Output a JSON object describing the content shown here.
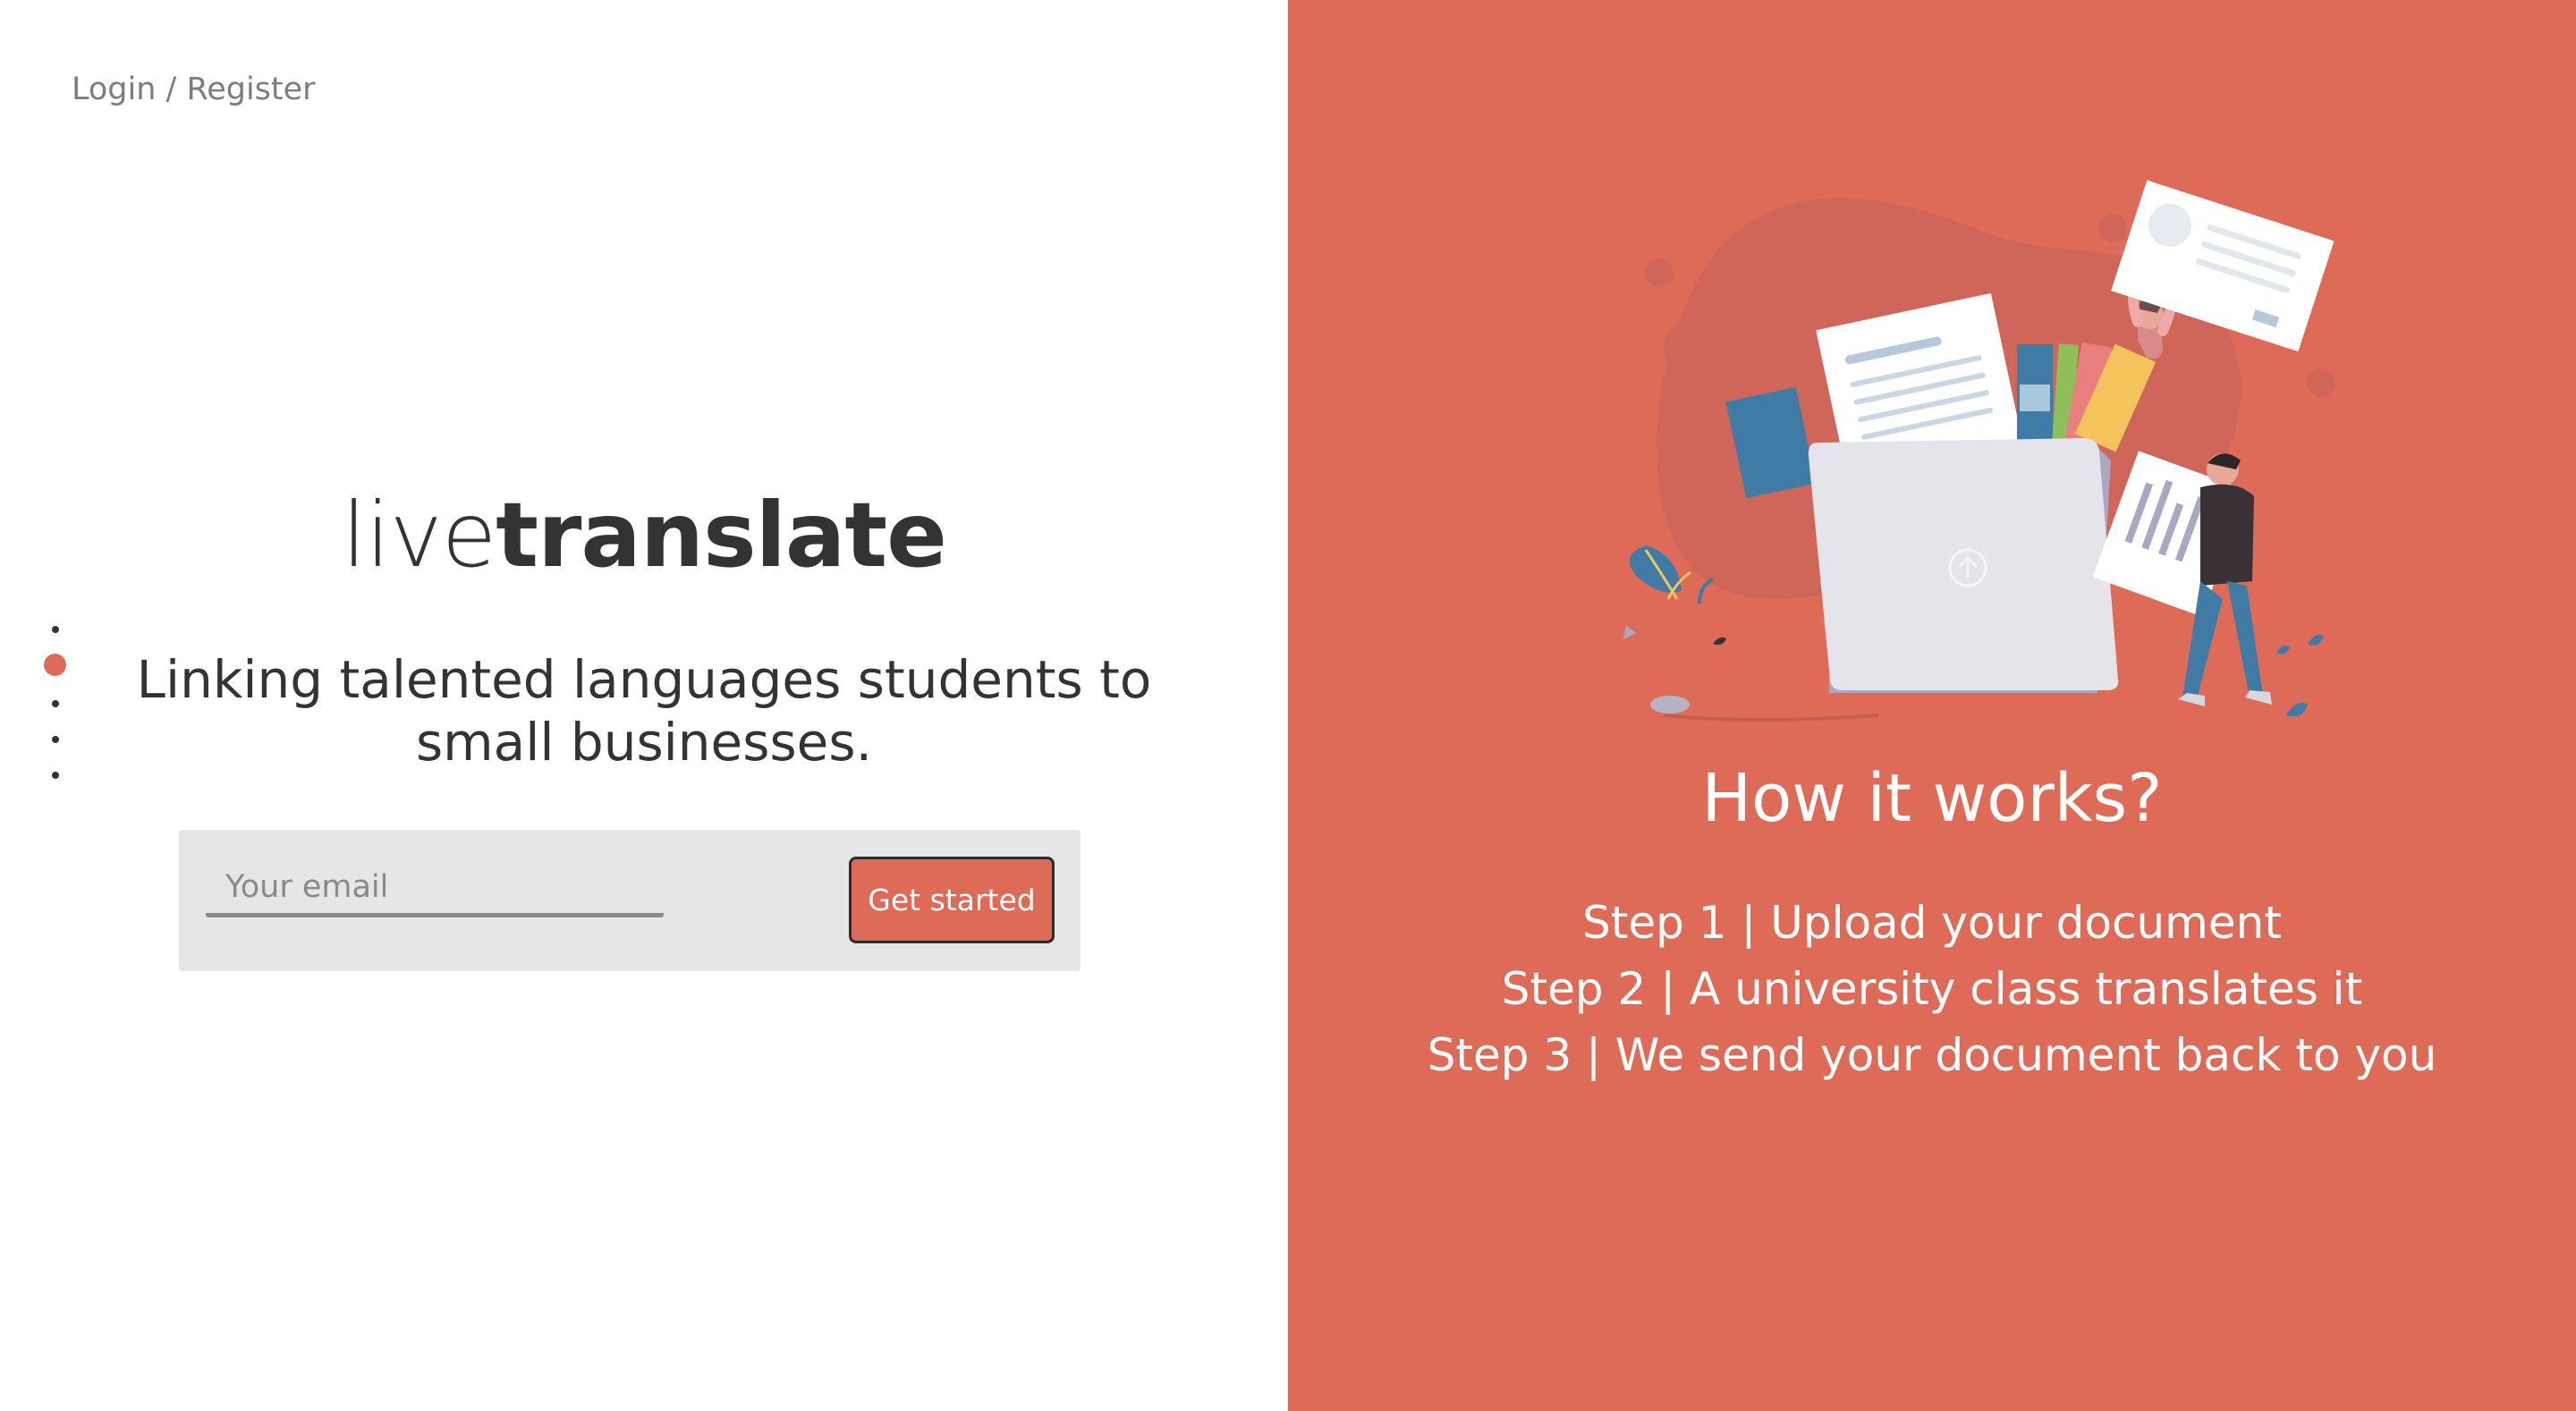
{
  "nav": {
    "login_register": "Login / Register"
  },
  "brand": {
    "light": "live",
    "bold": "translate"
  },
  "hero": {
    "tagline": "Linking talented languages students to small businesses."
  },
  "pagination": {
    "count": 5,
    "active_index": 1
  },
  "signup": {
    "email_placeholder": "Your email",
    "cta_label": "Get started"
  },
  "how_it_works": {
    "title": "How it works?",
    "steps": [
      "Step 1 | Upload your document",
      "Step 2 | A university class translates it",
      "Step 3 | We send your document back to you"
    ]
  },
  "colors": {
    "accent": "#de6a58",
    "text": "#333333",
    "muted": "#7d7d7d",
    "form_bg": "#e6e6e6"
  },
  "icons": {
    "illustration": "file-upload-illustration"
  }
}
